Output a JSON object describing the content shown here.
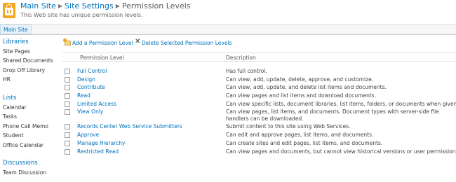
{
  "header": {
    "breadcrumb": {
      "site": "Main Site",
      "settings": "Site Settings",
      "current": "Permission Levels"
    },
    "description": "This Web site has unique permission levels.",
    "logo_icon": "shopping-bag-icon"
  },
  "topnav": {
    "tab": "Main Site"
  },
  "quicklaunch": {
    "libraries_heading": "Libraries",
    "libraries": [
      "Site Pages",
      "Shared Documents",
      "Drop Off Library",
      "HR"
    ],
    "lists_heading": "Lists",
    "lists": [
      "Calendar",
      "Tasks",
      "Phone Call Memo",
      "Student",
      "Office Calendar"
    ],
    "discussions_heading": "Discussions",
    "discussions": [
      "Team Discussion"
    ]
  },
  "toolbar": {
    "add_label": "Add a Permission Level",
    "delete_label": "Delete Selected Permission Levels"
  },
  "grid": {
    "columns": [
      "Permission Level",
      "Description"
    ],
    "rows": [
      {
        "name": "Full Control",
        "description": "Has full control."
      },
      {
        "name": "Design",
        "description": "Can view, add, update, delete, approve, and customize."
      },
      {
        "name": "Contribute",
        "description": "Can view, add, update, and delete list items and documents."
      },
      {
        "name": "Read",
        "description": "Can view pages and list items and download documents."
      },
      {
        "name": "Limited Access",
        "description": "Can view specific lists, document libraries, list items, folders, or documents when given permission"
      },
      {
        "name": "View Only",
        "description": "Can view pages, list items, and documents. Document types with server-side file handlers can be downloaded."
      },
      {
        "name": "Records Center Web Service Submitters",
        "description": "Submit content to this site using Web Services."
      },
      {
        "name": "Approve",
        "description": "Can edit and approve pages, list items, and documents."
      },
      {
        "name": "Manage Hierarchy",
        "description": "Can create sites and edit pages, list items, and documents."
      },
      {
        "name": "Restricted Read",
        "description": "Can view pages and documents, but cannot view historical versions or user permissions."
      }
    ]
  },
  "colors": {
    "link": "#0072bc",
    "logo": "#f3a61e",
    "text": "#444444"
  }
}
